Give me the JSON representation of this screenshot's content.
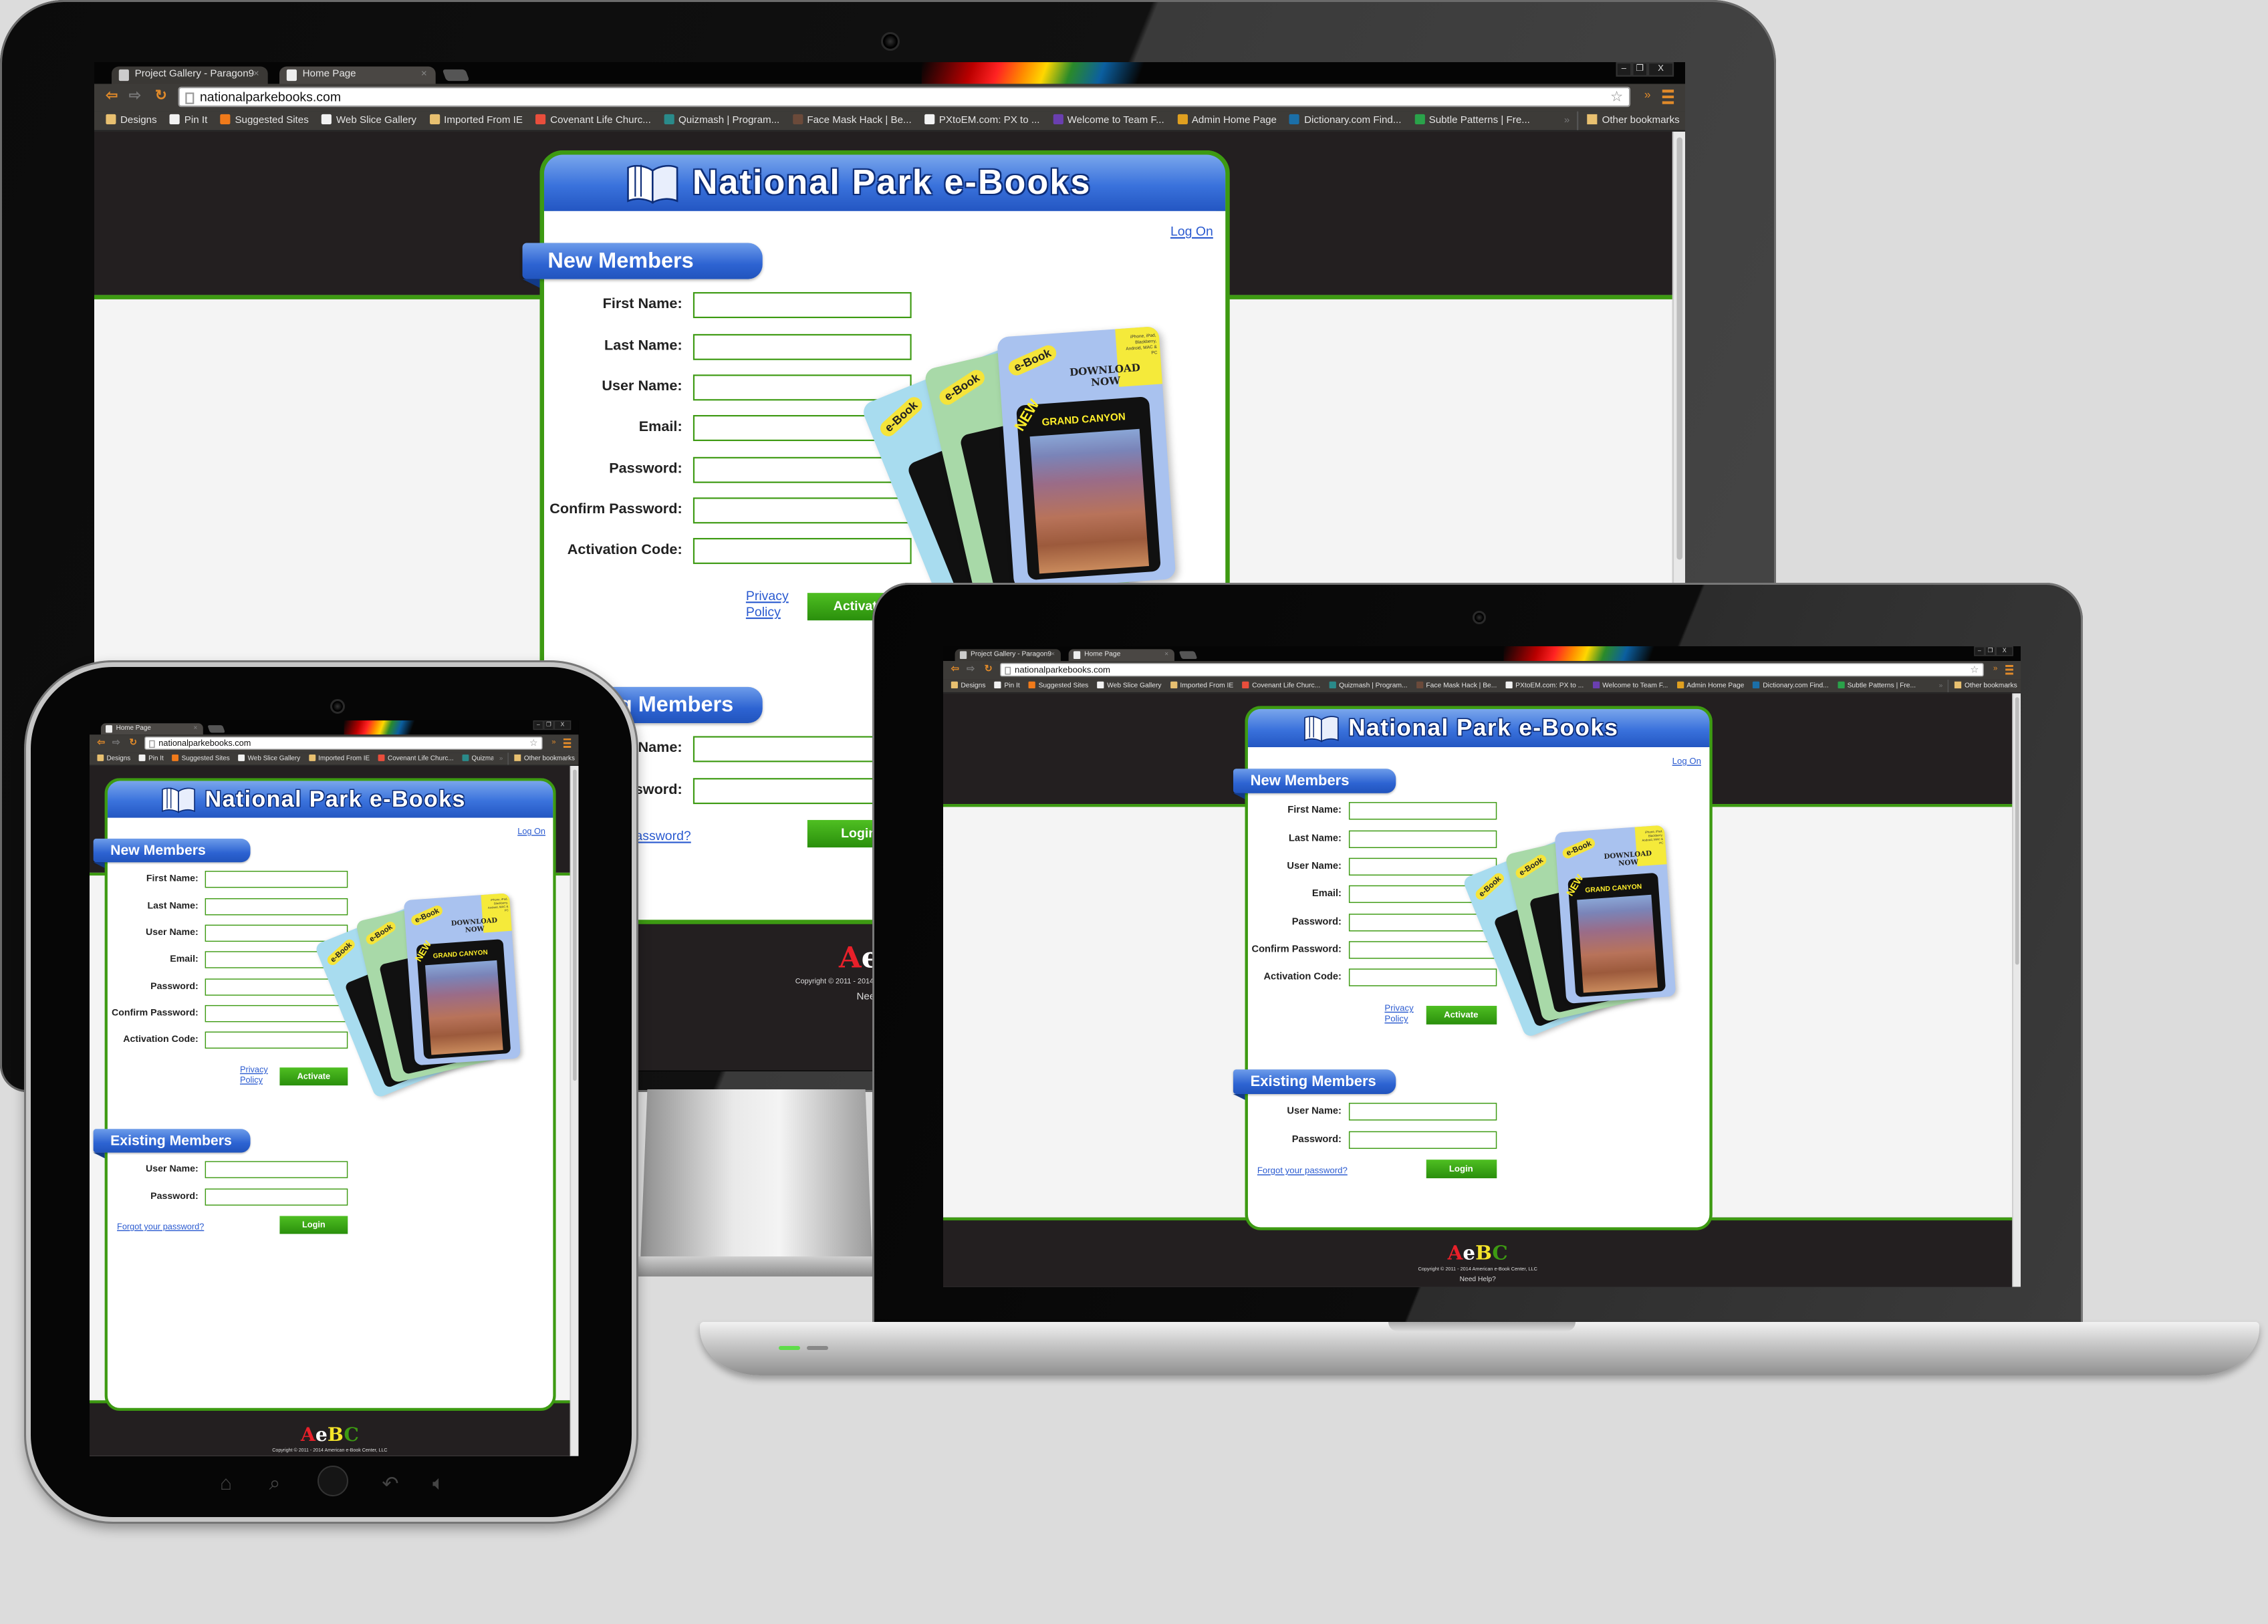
{
  "browser": {
    "tabs": [
      {
        "label": "Project Gallery - Paragon9",
        "icon": "p9-favicon"
      },
      {
        "label": "Home Page",
        "icon": "page-icon"
      }
    ],
    "window_controls": {
      "minimize": "–",
      "restore": "❐",
      "close": "X"
    },
    "url": "nationalparkebooks.com",
    "bookmarks": [
      {
        "label": "Designs",
        "icon": "folder"
      },
      {
        "label": "Pin It",
        "icon": "page"
      },
      {
        "label": "Suggested Sites",
        "icon": "suggested-sites"
      },
      {
        "label": "Web Slice Gallery",
        "icon": "page"
      },
      {
        "label": "Imported From IE",
        "icon": "folder"
      },
      {
        "label": "Covenant Life Churc...",
        "icon": "joomla"
      },
      {
        "label": "Quizmash | Program...",
        "icon": "quizmash"
      },
      {
        "label": "Face Mask Hack | Be...",
        "icon": "facemask"
      },
      {
        "label": "PXtoEM.com: PX to ...",
        "icon": "page"
      },
      {
        "label": "Welcome to Team F...",
        "icon": "visual-studio"
      },
      {
        "label": "Admin Home Page",
        "icon": "admin"
      },
      {
        "label": "Dictionary.com Find...",
        "icon": "dictionary"
      },
      {
        "label": "Subtle Patterns | Fre...",
        "icon": "subtle-patterns"
      }
    ],
    "more_bookmarks": "»",
    "other_bookmarks": "Other bookmarks"
  },
  "site": {
    "title": "National Park e-Books",
    "log_on": "Log On",
    "new_members": {
      "heading": "New Members",
      "fields": [
        {
          "label": "First Name:",
          "value": ""
        },
        {
          "label": "Last Name:",
          "value": ""
        },
        {
          "label": "User Name:",
          "value": ""
        },
        {
          "label": "Email:",
          "value": ""
        },
        {
          "label": "Password:",
          "value": ""
        },
        {
          "label": "Confirm Password:",
          "value": ""
        },
        {
          "label": "Activation Code:",
          "value": ""
        }
      ],
      "privacy_policy": "Privacy Policy",
      "activate": "Activate"
    },
    "existing_members": {
      "heading": "Existing Members",
      "fields": [
        {
          "label": "User Name:",
          "value": ""
        },
        {
          "label": "Password:",
          "value": ""
        }
      ],
      "forgot_password": "Forgot your password?",
      "login": "Login"
    },
    "promo": {
      "badge": "e-Book",
      "download": "DOWNLOAD NOW",
      "new": "NEW",
      "park": "GRAND CANYON",
      "platforms": "iPhone, iPad, Blackberry, Android, MAC & PC"
    },
    "footer": {
      "logo": "AeBC",
      "copyright": "Copyright © 2011 - 2014 American e-Book Center, LLC",
      "help": "Need Help?"
    }
  },
  "colors": {
    "accent_green": "#3d9a12",
    "header_blue": "#2d63d2",
    "dark_band": "#231f20",
    "link": "#2b5bd0"
  }
}
